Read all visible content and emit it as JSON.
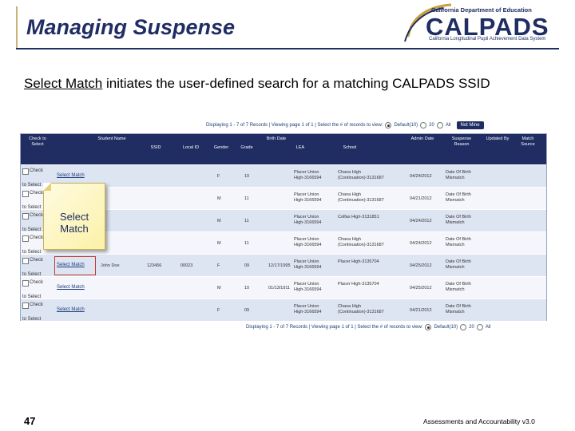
{
  "slide": {
    "title": "Managing Suspense",
    "intro_link": "Select Match",
    "intro_rest": " initiates the user-defined search for a matching CALPADS SSID",
    "page_number": "47",
    "footer": "Assessments and Accountability v3.0"
  },
  "logo": {
    "dept": "California Department of Education",
    "word": "CALPADS",
    "tagline": "California Longitudinal Pupil Achievement Data System"
  },
  "pager_top": {
    "text": "Displaying 1 - 7 of 7 Records | Viewing page 1 of 1 | Select the # of records to view:",
    "opt_default": "Default(10)",
    "opt_20": "20",
    "opt_all": "All",
    "selected": "Default(10)",
    "not_me_label": "Not Mine"
  },
  "pager_bottom": {
    "text": "Displaying 1 - 7 of 7 Records | Viewing page 1 of 1 | Select the # of records to view:",
    "opt_default": "Default(10)",
    "opt_20": "20",
    "opt_all": "All",
    "selected": "Default(10)"
  },
  "table": {
    "columns": {
      "check": "Check to Select",
      "student_name": "Student Name",
      "ssid": "SSID",
      "local_id": "Local ID",
      "gender": "Gender",
      "grade": "Grade",
      "birth_date": "Birth Date",
      "lea": "LEA",
      "school": "School",
      "admin_date": "Admin Date",
      "suspense_reason": "Suspense Reason",
      "updated_by": "Updated By",
      "match_source": "Match Source"
    },
    "check_label_1": "Check",
    "check_label_2": "to Select",
    "rows": [
      {
        "select": "Select Match",
        "name": "",
        "ssid": "",
        "local_id": "",
        "gender": "F",
        "grade": "10",
        "birth": "",
        "lea_1": "Placer Union",
        "lea_2": "High-3166594",
        "school_1": "Chana High",
        "school_2": "(Continuation)-3131687",
        "admin": "04/24/2012",
        "reason_1": "Date Of Birth",
        "reason_2": "Mismatch"
      },
      {
        "select": "",
        "name": "",
        "ssid": "",
        "local_id": "",
        "gender": "M",
        "grade": "11",
        "birth": "",
        "lea_1": "Placer Union",
        "lea_2": "High-3166594",
        "school_1": "Chana High",
        "school_2": "(Continuation)-3131687",
        "admin": "04/21/2012",
        "reason_1": "Date Of Birth",
        "reason_2": "Mismatch"
      },
      {
        "select": "",
        "name": "",
        "ssid": "",
        "local_id": "",
        "gender": "M",
        "grade": "11",
        "birth": "",
        "lea_1": "Placer Union",
        "lea_2": "High-3166594",
        "school_1": "Colfax High-3131851",
        "school_2": "",
        "admin": "04/24/2012",
        "reason_1": "Date Of Birth",
        "reason_2": "Mismatch"
      },
      {
        "select": "",
        "name": "",
        "ssid": "",
        "local_id": "",
        "gender": "M",
        "grade": "11",
        "birth": "",
        "lea_1": "Placer Union",
        "lea_2": "High-3166594",
        "school_1": "Chana High",
        "school_2": "(Continuation)-3131687",
        "admin": "04/24/2012",
        "reason_1": "Date Of Birth",
        "reason_2": "Mismatch"
      },
      {
        "select": "Select Match",
        "name": "John Doe",
        "ssid": "123456",
        "local_id": "00023",
        "gender": "F",
        "grade": "09",
        "birth": "12/17/1995",
        "lea_1": "Placer Union",
        "lea_2": "High-3166594",
        "school_1": "Placer High-3135704",
        "school_2": "",
        "admin": "04/25/2012",
        "reason_1": "Date Of Birth",
        "reason_2": "Mismatch"
      },
      {
        "select": "Select Match",
        "name": "",
        "ssid": "",
        "local_id": "",
        "gender": "M",
        "grade": "10",
        "birth": "01/13/1911",
        "lea_1": "Placer Union",
        "lea_2": "High-3166594",
        "school_1": "Placer High-3135704",
        "school_2": "",
        "admin": "04/25/2012",
        "reason_1": "Date Of Birth",
        "reason_2": "Mismatch"
      },
      {
        "select": "Select Match",
        "name": "",
        "ssid": "",
        "local_id": "",
        "gender": "F",
        "grade": "09",
        "birth": "",
        "lea_1": "Placer Union",
        "lea_2": "High-3166594",
        "school_1": "Chana High",
        "school_2": "(Continuation)-3131687",
        "admin": "04/21/2012",
        "reason_1": "Date Of Birth",
        "reason_2": "Mismatch"
      }
    ]
  },
  "callout": {
    "line1": "Select",
    "line2": "Match"
  },
  "colors": {
    "header_navy": "#1f2d63",
    "row_alt": "#dde4f2",
    "highlight_red": "#c0392b",
    "callout_yellow": "#fbf1a8"
  }
}
